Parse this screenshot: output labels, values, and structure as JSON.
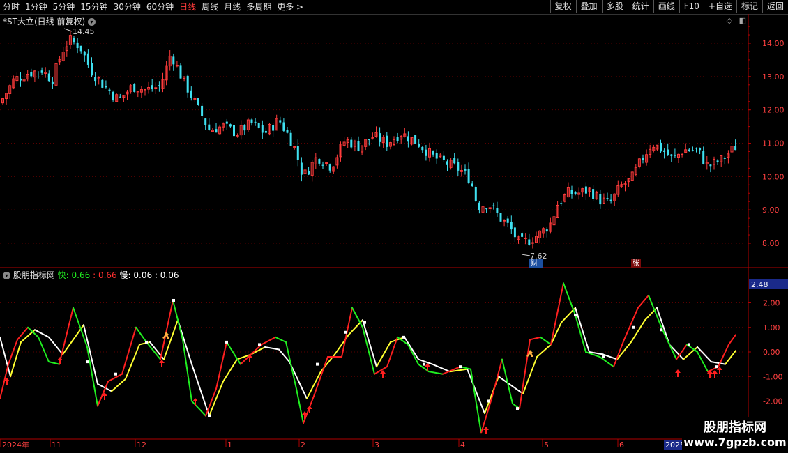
{
  "toolbar": {
    "periods": [
      "分时",
      "1分钟",
      "5分钟",
      "15分钟",
      "30分钟",
      "60分钟",
      "日线",
      "周线",
      "月线",
      "多周期",
      "更多 >"
    ],
    "active_period": "日线",
    "actions": [
      "复权",
      "叠加",
      "多股",
      "统计",
      "画线",
      "F10",
      "+自选",
      "标记",
      "返回"
    ]
  },
  "main_panel": {
    "title": "*ST大立(日线 前复权)",
    "high_label": "14.45",
    "low_label": "7.62",
    "tag_left": "财",
    "tag_right": "张",
    "y_ticks": [
      "14.00",
      "13.00",
      "12.00",
      "11.00",
      "10.00",
      "9.00",
      "8.00"
    ]
  },
  "indicator_panel": {
    "name": "股朋指标网",
    "fast_label": "快:",
    "fast_value1": "0.66",
    "fast_value2": ": 0.66",
    "slow_label": "慢:",
    "slow_value1": "0.06",
    "slow_value2": ": 0.06",
    "current_value": "2.48",
    "y_ticks": [
      "2.00",
      "1.00",
      "0.00",
      "-1.00",
      "-2.00"
    ]
  },
  "x_axis": {
    "labels": [
      "2024年",
      "11",
      "12",
      "1",
      "2",
      "3",
      "4",
      "5",
      "6",
      "2025/"
    ]
  },
  "colors": {
    "up": "#ff3b3b",
    "down": "#3fe0f0",
    "fast_up": "#ff2020",
    "fast_down": "#20ee20",
    "slow_up": "#ffff30",
    "slow_down": "#ffffff",
    "axis": "#b00000"
  },
  "watermark": {
    "line1": "股朋指标网",
    "line2": "www.7gpzb.com"
  }
}
